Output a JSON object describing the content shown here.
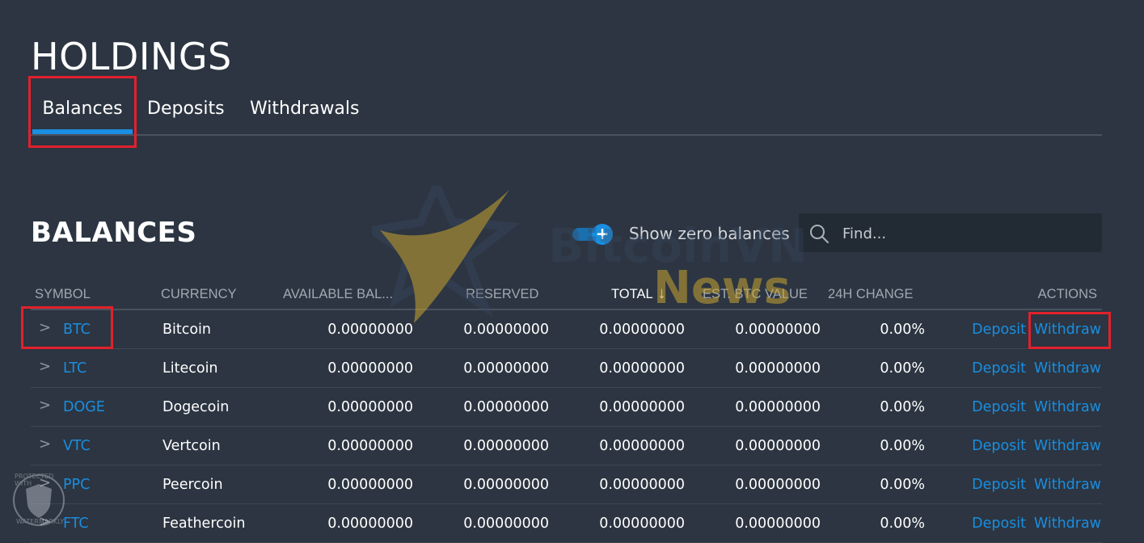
{
  "page": {
    "title": "HOLDINGS"
  },
  "tabs": [
    {
      "label": "Balances",
      "active": true
    },
    {
      "label": "Deposits",
      "active": false
    },
    {
      "label": "Withdrawals",
      "active": false
    }
  ],
  "balances": {
    "title": "BALANCES",
    "toggle": {
      "label": "Show zero balances",
      "on": true,
      "icon": "plus-icon"
    },
    "search": {
      "placeholder": "Find...",
      "value": ""
    },
    "columns": {
      "symbol": "SYMBOL",
      "currency": "CURRENCY",
      "available": "AVAILABLE BAL...",
      "reserved": "RESERVED",
      "total": "TOTAL",
      "btc_value": "EST. BTC VALUE",
      "change": "24H CHANGE",
      "actions": "ACTIONS"
    },
    "sort_icon": "arrow-down-icon",
    "actions": {
      "deposit": "Deposit",
      "withdraw": "Withdraw"
    },
    "rows": [
      {
        "symbol": "BTC",
        "currency": "Bitcoin",
        "available": "0.00000000",
        "reserved": "0.00000000",
        "total": "0.00000000",
        "btc_value": "0.00000000",
        "change": "0.00%"
      },
      {
        "symbol": "LTC",
        "currency": "Litecoin",
        "available": "0.00000000",
        "reserved": "0.00000000",
        "total": "0.00000000",
        "btc_value": "0.00000000",
        "change": "0.00%"
      },
      {
        "symbol": "DOGE",
        "currency": "Dogecoin",
        "available": "0.00000000",
        "reserved": "0.00000000",
        "total": "0.00000000",
        "btc_value": "0.00000000",
        "change": "0.00%"
      },
      {
        "symbol": "VTC",
        "currency": "Vertcoin",
        "available": "0.00000000",
        "reserved": "0.00000000",
        "total": "0.00000000",
        "btc_value": "0.00000000",
        "change": "0.00%"
      },
      {
        "symbol": "PPC",
        "currency": "Peercoin",
        "available": "0.00000000",
        "reserved": "0.00000000",
        "total": "0.00000000",
        "btc_value": "0.00000000",
        "change": "0.00%"
      },
      {
        "symbol": "FTC",
        "currency": "Feathercoin",
        "available": "0.00000000",
        "reserved": "0.00000000",
        "total": "0.00000000",
        "btc_value": "0.00000000",
        "change": "0.00%"
      }
    ]
  },
  "watermark": {
    "line1": "BitcoinVN",
    "line2": "News",
    "badge_line1": "PROTECTED WITH",
    "badge_line2": "WATERMARKLY"
  },
  "colors": {
    "background": "#2c3541",
    "accent": "#1a8ee0",
    "highlight": "#e1212b",
    "search_bg": "#222a34"
  }
}
